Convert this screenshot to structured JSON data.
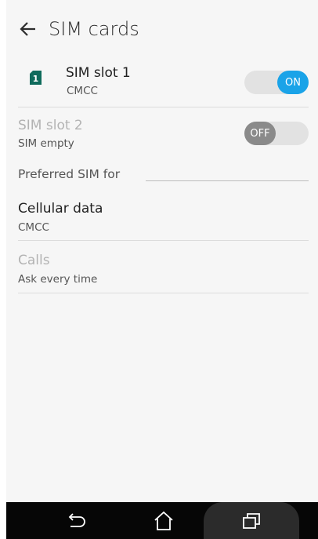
{
  "header": {
    "title": "SIM cards"
  },
  "sim_slot_1": {
    "title": "SIM slot 1",
    "carrier": "CMCC",
    "toggle_label": "ON",
    "enabled": true
  },
  "sim_slot_2": {
    "title": "SIM slot 2",
    "status": "SIM empty",
    "toggle_label": "OFF",
    "enabled": false
  },
  "preferred": {
    "section_title": "Preferred SIM for",
    "cellular_data": {
      "title": "Cellular data",
      "value": "CMCC"
    },
    "calls": {
      "title": "Calls",
      "value": "Ask every time"
    }
  },
  "colors": {
    "accent": "#1aa3e8",
    "sim_icon": "#0f6b5c"
  },
  "navbar": {
    "icons": [
      "back-icon",
      "home-icon",
      "recents-icon"
    ]
  }
}
